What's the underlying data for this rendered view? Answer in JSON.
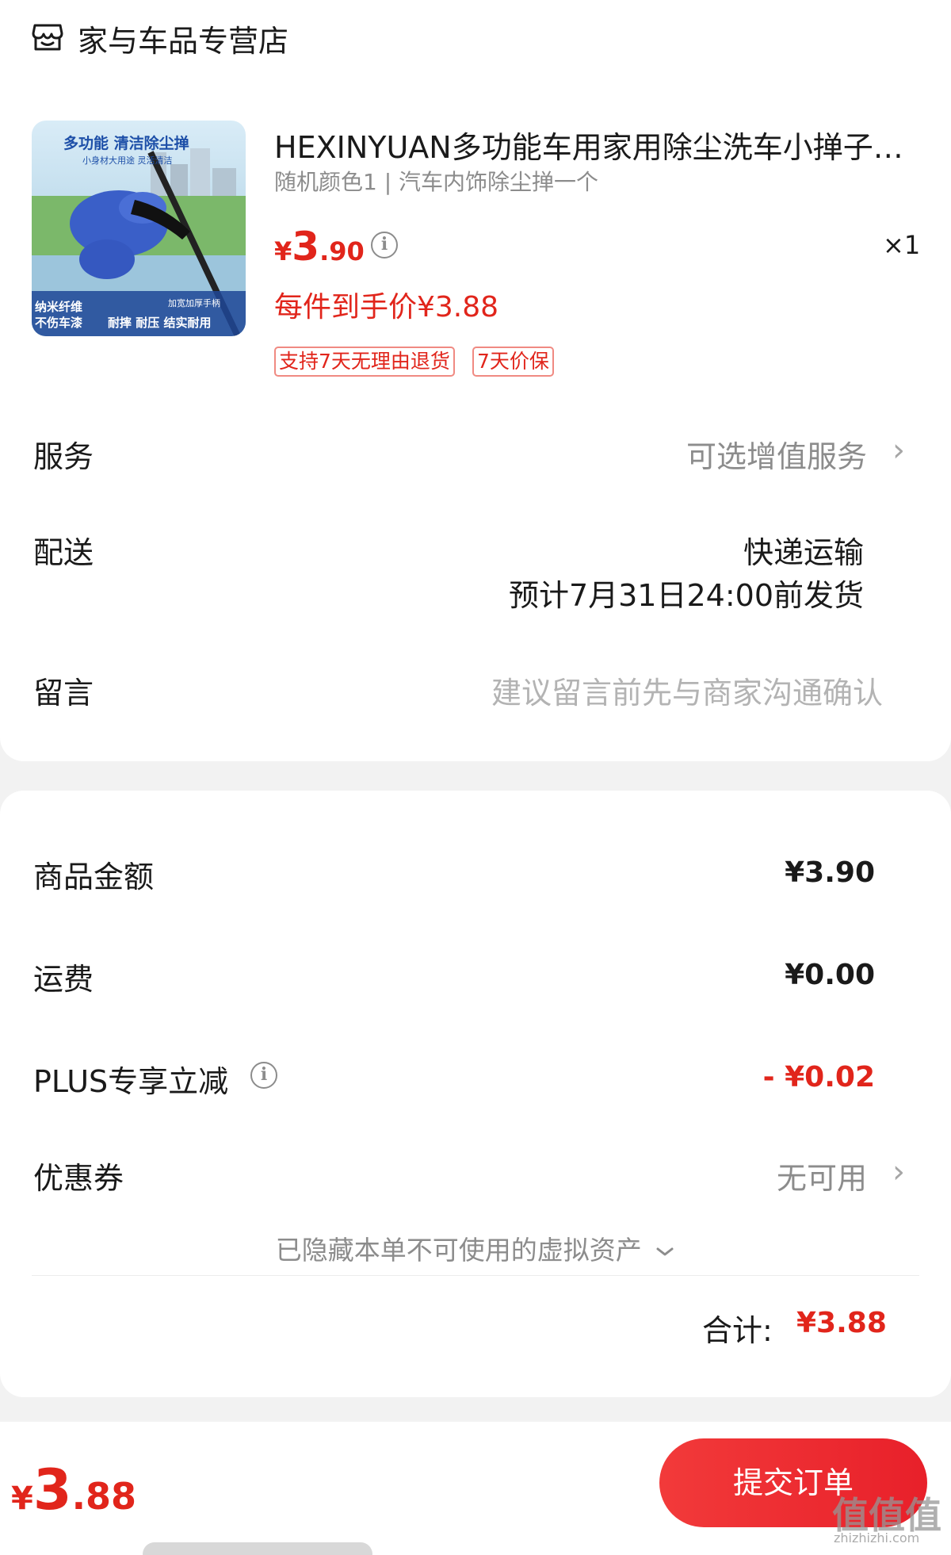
{
  "store": {
    "name": "家与车品专营店",
    "icon": "store-icon"
  },
  "product": {
    "title": "HEXINYUAN多功能车用家用除尘洗车小掸子…",
    "spec": "随机颜色1 | 汽车内饰除尘掸一个",
    "price_currency": "¥",
    "price_integer": "3",
    "price_decimal": ".90",
    "quantity": "×1",
    "deal_price": "每件到手价¥3.88",
    "tags": [
      "支持7天无理由退货",
      "7天价保"
    ],
    "image": {
      "headline": "多功能 清洁除尘掸",
      "subline": "小身材大用途 灵活清洁",
      "badge_left_1": "纳米纤维",
      "badge_left_2": "不伤车漆",
      "badge_right_1": "加宽加厚手柄",
      "badge_right_2": "耐摔 耐压 结实耐用"
    }
  },
  "service": {
    "label": "服务",
    "value": "可选增值服务"
  },
  "shipping": {
    "label": "配送",
    "method": "快递运输",
    "eta": "预计7月31日24:00前发货"
  },
  "message": {
    "label": "留言",
    "placeholder": "建议留言前先与商家沟通确认"
  },
  "summary": {
    "goods_label": "商品金额",
    "goods_value": "¥3.90",
    "freight_label": "运费",
    "freight_value": "¥0.00",
    "plus_label": "PLUS专享立减",
    "plus_value": "- ¥0.02",
    "coupon_label": "优惠券",
    "coupon_value": "无可用",
    "hidden_note": "已隐藏本单不可使用的虚拟资产",
    "total_label": "合计:",
    "total_value": "¥3.88"
  },
  "bottom": {
    "currency": "¥",
    "integer": "3",
    "decimal": ".88",
    "submit_label": "提交订单"
  },
  "watermark": {
    "text": "值值值",
    "sub": "zhizhizhi.com"
  },
  "colors": {
    "accent": "#e1251b",
    "button": "#f23a3a",
    "background": "#f2f2f2"
  }
}
